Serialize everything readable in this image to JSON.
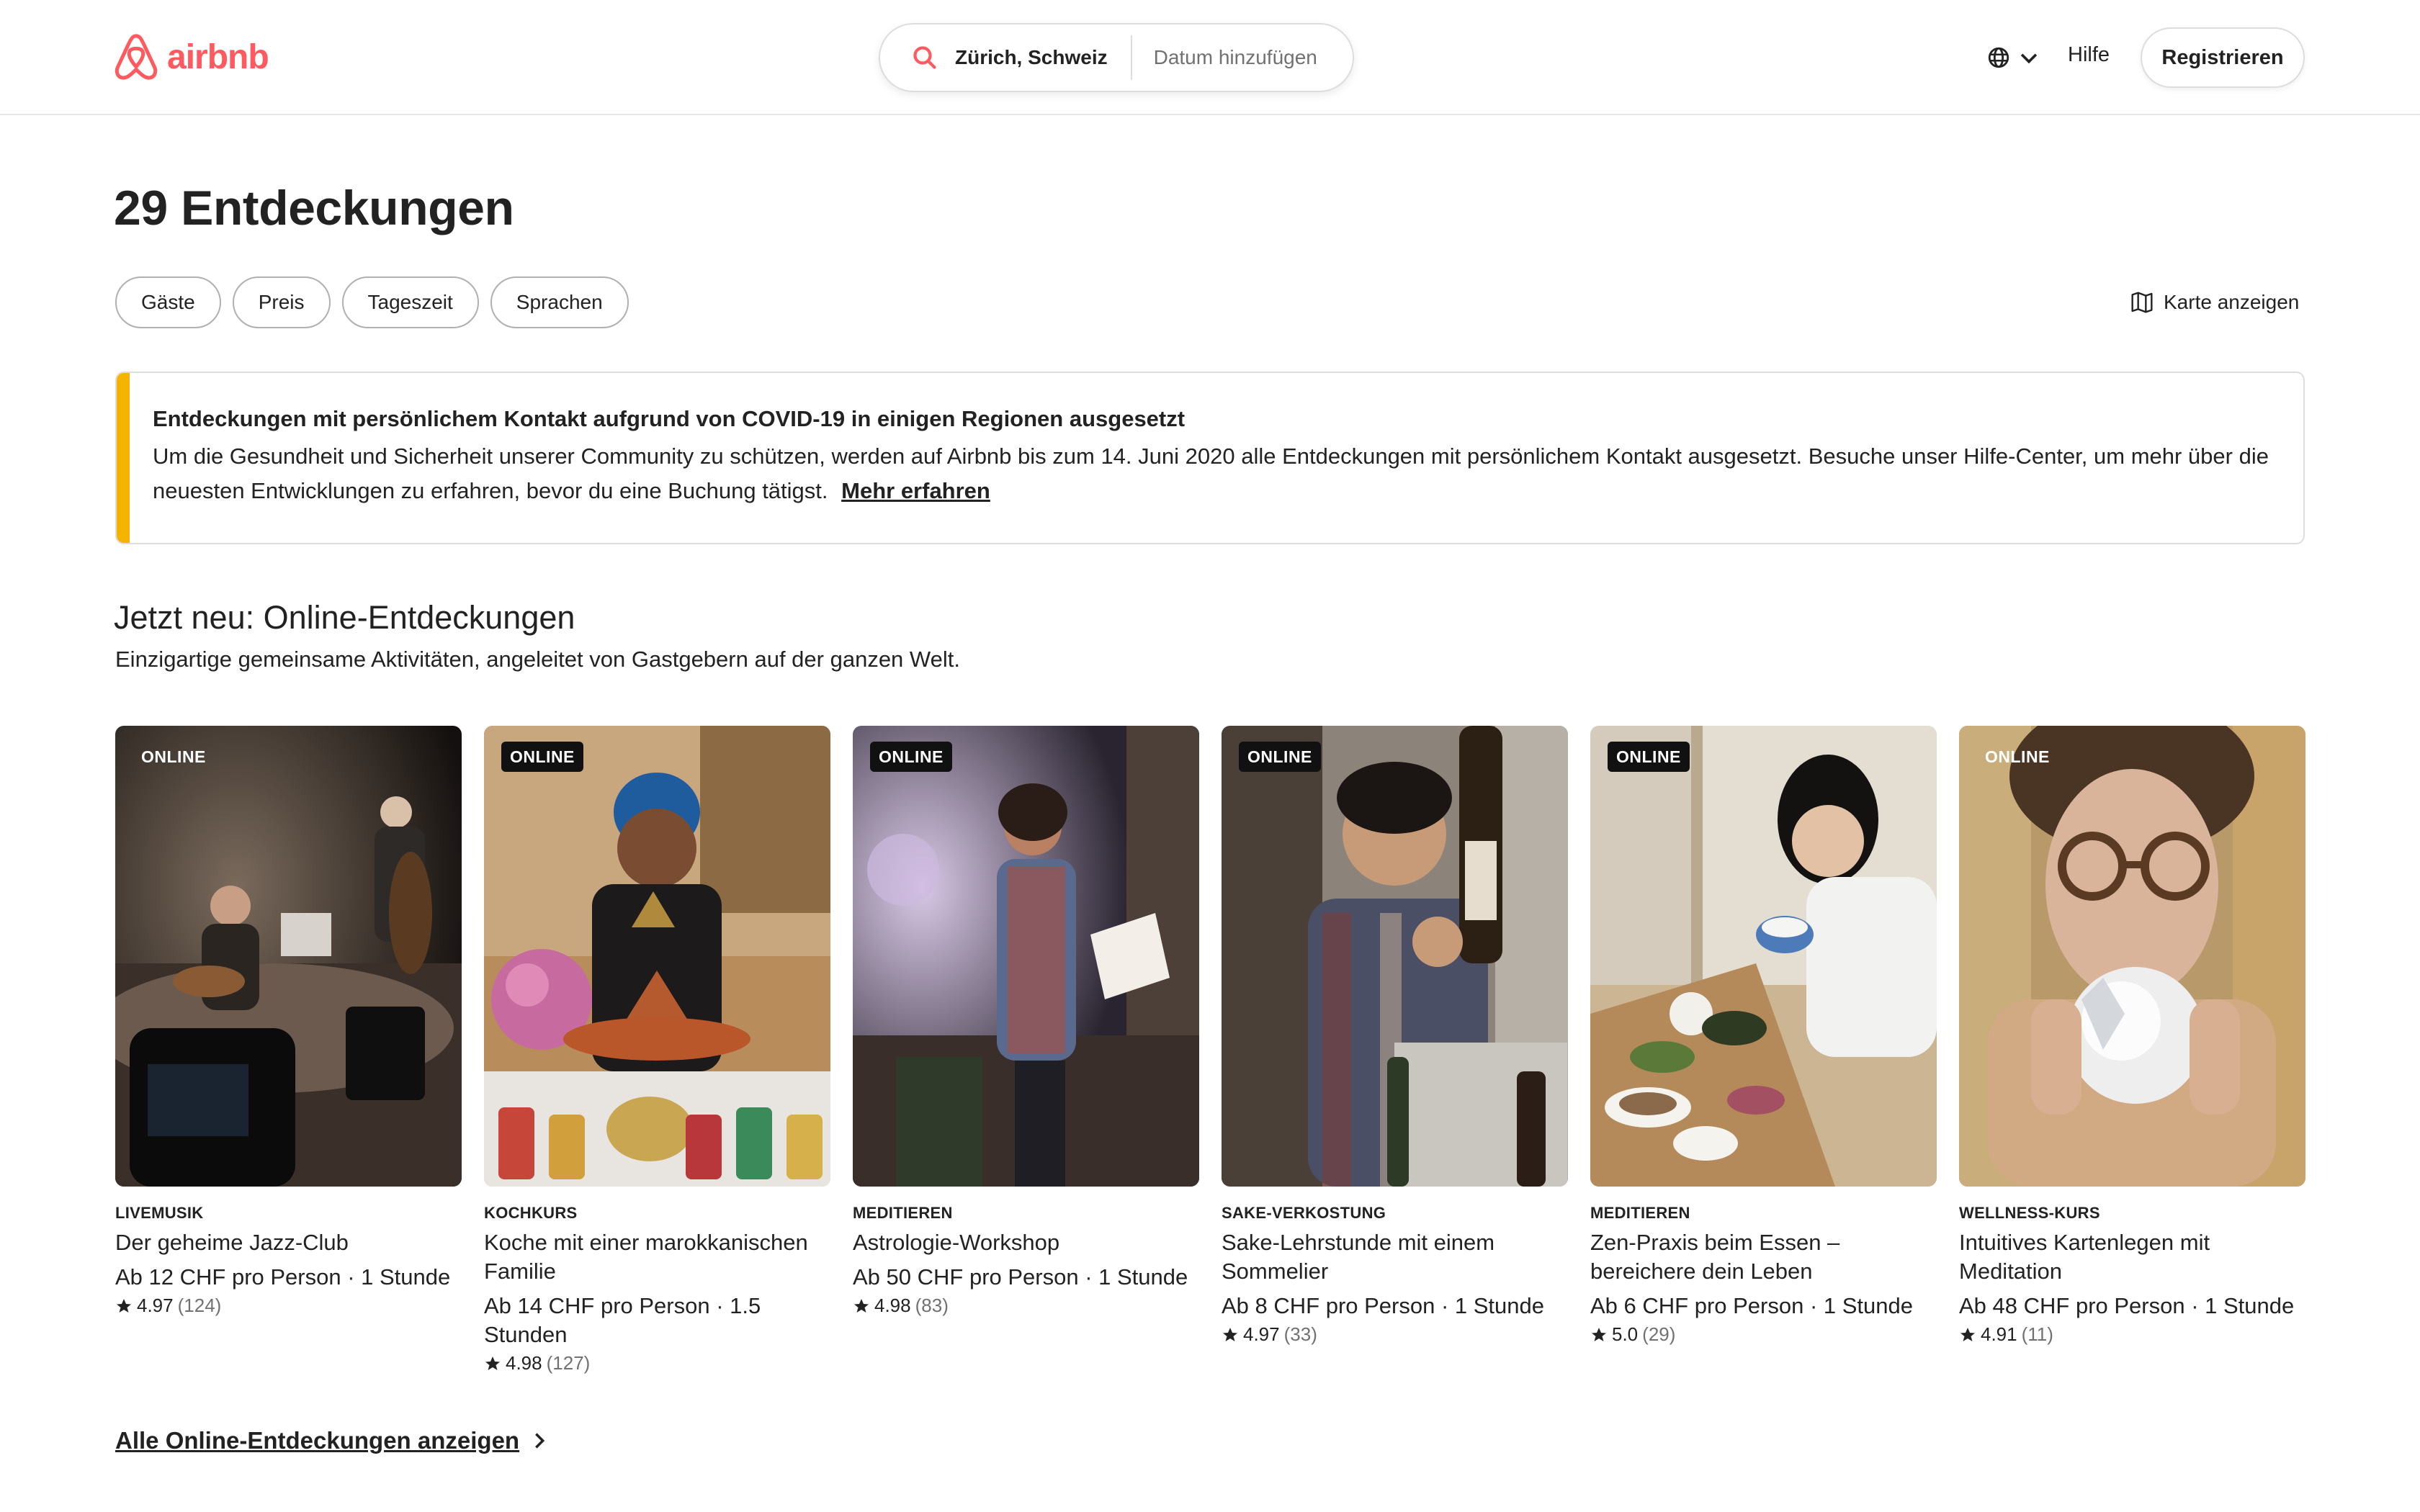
{
  "header": {
    "brand": "airbnb",
    "search_location": "Zürich, Schweiz",
    "search_date_placeholder": "Datum hinzufügen",
    "help_label": "Hilfe",
    "register_label": "Registrieren",
    "brand_color": "#ff5a5f"
  },
  "page": {
    "title": "29 Entdeckungen",
    "filters": [
      "Gäste",
      "Preis",
      "Tageszeit",
      "Sprachen"
    ],
    "map_toggle": "Karte anzeigen"
  },
  "notice": {
    "title": "Entdeckungen mit persönlichem Kontakt aufgrund von COVID-19 in einigen Regionen ausgesetzt",
    "body": "Um die Gesundheit und Sicherheit unserer Community zu schützen, werden auf Airbnb bis zum 14. Juni 2020 alle Entdeckungen mit persönlichem Kontakt ausgesetzt. Besuche unser Hilfe-Center, um mehr über die neuesten Entwicklungen zu erfahren, bevor du eine Buchung tätigst.",
    "link": "Mehr erfahren",
    "accent_color": "#f4b400"
  },
  "section": {
    "title": "Jetzt neu: Online-Entdeckungen",
    "subtitle": "Einzigartige gemeinsame Aktivitäten, angeleitet von Gastgebern auf der ganzen Welt.",
    "all_link": "Alle Online-Entdeckungen anzeigen"
  },
  "cards": [
    {
      "badge": "ONLINE",
      "category": "LIVEMUSIK",
      "title": "Der geheime Jazz-Club",
      "price": "Ab 12 CHF pro Person · 1 Stunde",
      "rating": "4.97",
      "count": "(124)"
    },
    {
      "badge": "ONLINE",
      "category": "KOCHKURS",
      "title": "Koche mit einer marokkanischen Familie",
      "price": "Ab 14 CHF pro Person · 1.5 Stunden",
      "rating": "4.98",
      "count": "(127)"
    },
    {
      "badge": "ONLINE",
      "category": "MEDITIEREN",
      "title": "Astrologie-Workshop",
      "price": "Ab 50 CHF pro Person · 1 Stunde",
      "rating": "4.98",
      "count": "(83)"
    },
    {
      "badge": "ONLINE",
      "category": "SAKE-VERKOSTUNG",
      "title": "Sake-Lehrstunde mit einem Sommelier",
      "price": "Ab 8 CHF pro Person · 1 Stunde",
      "rating": "4.97",
      "count": "(33)"
    },
    {
      "badge": "ONLINE",
      "category": "MEDITIEREN",
      "title": "Zen-Praxis beim Essen – bereichere dein Leben",
      "price": "Ab 6 CHF pro Person · 1 Stunde",
      "rating": "5.0",
      "count": "(29)"
    },
    {
      "badge": "ONLINE",
      "category": "WELLNESS-KURS",
      "title": "Intuitives Kartenlegen mit Meditation",
      "price": "Ab 48 CHF pro Person · 1 Stunde",
      "rating": "4.91",
      "count": "(11)"
    }
  ]
}
